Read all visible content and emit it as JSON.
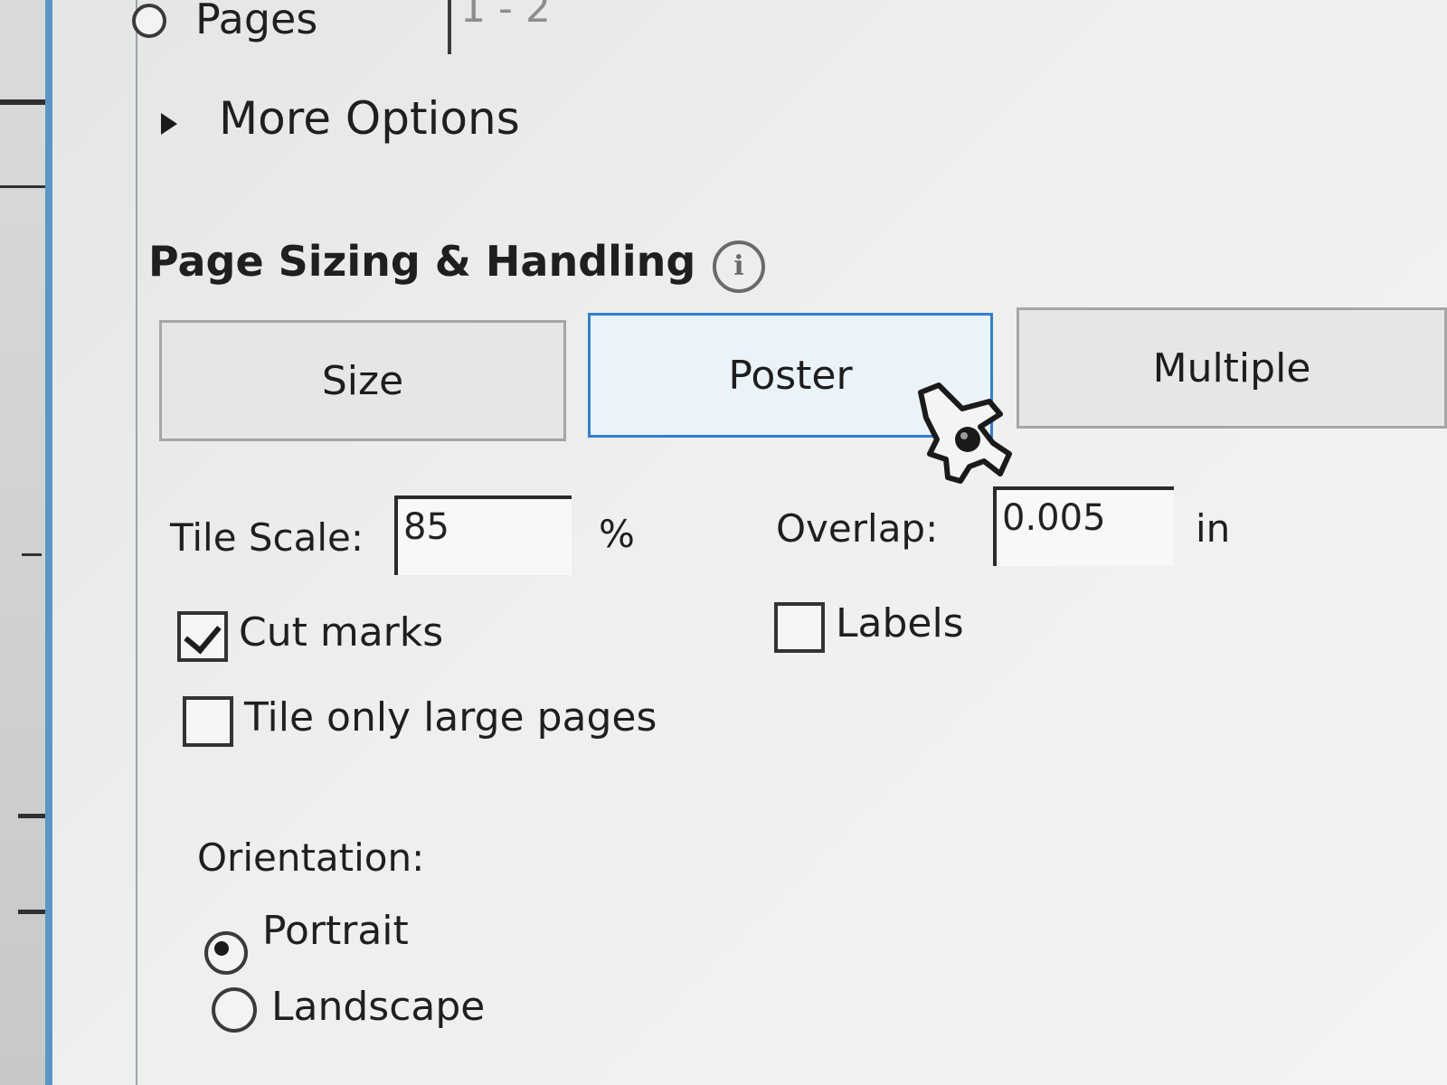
{
  "print_dialog": {
    "pages_radio_label": "Pages",
    "pages_value": "1 - 2",
    "more_options_label": "More Options",
    "section_title": "Page Sizing & Handling",
    "info_icon": "info-icon",
    "sizing_tabs": [
      {
        "label": "Size",
        "selected": false
      },
      {
        "label": "Poster",
        "selected": true
      },
      {
        "label": "Multiple",
        "selected": false
      }
    ],
    "tile_scale_label": "Tile Scale:",
    "tile_scale_value": "85",
    "tile_scale_unit": "%",
    "overlap_label": "Overlap:",
    "overlap_value": "0.005",
    "overlap_unit": "in",
    "cut_marks_label": "Cut marks",
    "cut_marks_checked": true,
    "labels_label": "Labels",
    "labels_checked": false,
    "tile_large_label": "Tile only large pages",
    "tile_large_checked": false,
    "orientation_label": "Orientation:",
    "portrait_label": "Portrait",
    "portrait_selected": true,
    "landscape_label": "Landscape",
    "landscape_selected": false
  },
  "colors": {
    "accent": "#2f7fd0",
    "panel_border": "#5c95c8",
    "text": "#1f1f1f"
  },
  "cursor": "hand-pointer-icon"
}
